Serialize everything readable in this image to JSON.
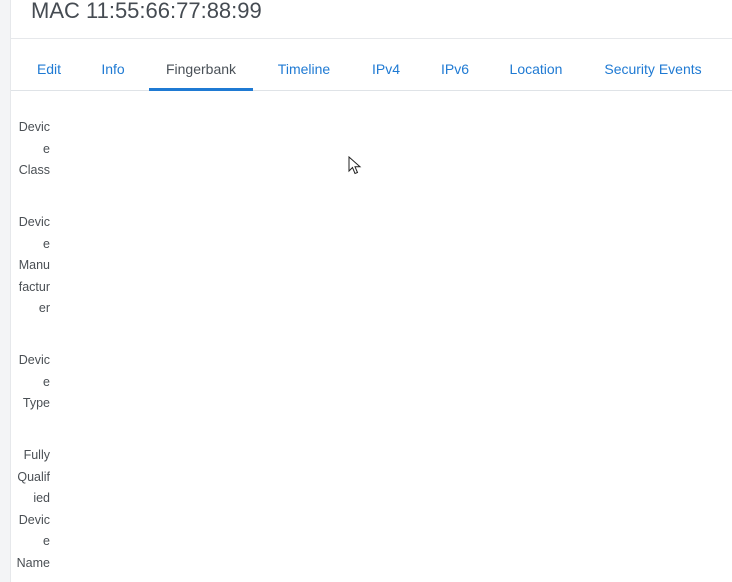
{
  "header": {
    "title": "MAC 11:55:66:77:88:99"
  },
  "tabs": [
    {
      "label": "Edit"
    },
    {
      "label": "Info"
    },
    {
      "label": "Fingerbank"
    },
    {
      "label": "Timeline"
    },
    {
      "label": "IPv4"
    },
    {
      "label": "IPv6"
    },
    {
      "label": "Location"
    },
    {
      "label": "Security Events"
    }
  ],
  "active_tab": "Fingerbank",
  "fields": [
    {
      "label": "Devic\ne\nClass"
    },
    {
      "label": "Devic\ne\nManu\nfactur\ner"
    },
    {
      "label": "Devic\ne\nType"
    },
    {
      "label": "Fully\nQualif\nied\nDevic\ne\nName"
    }
  ],
  "colors": {
    "accent": "#1f7ad3",
    "text": "#495057",
    "divider": "#dfe3e7"
  }
}
